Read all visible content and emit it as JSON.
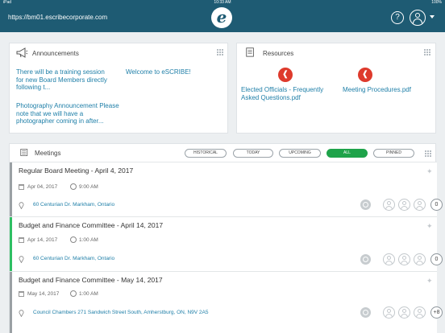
{
  "status_bar": {
    "carrier": "iPad",
    "time": "10:33 AM",
    "battery": "100%"
  },
  "header": {
    "url": "https://bm01.escribecorporate.com",
    "logo_letter": "e",
    "help_glyph": "?"
  },
  "announcements": {
    "title": "Announcements",
    "items": [
      "There will be a training session for new Board Members directly following t...",
      "Welcome to eSCRIBE!",
      "Photography Announcement Please note that we will have a photographer coming in after..."
    ]
  },
  "resources": {
    "title": "Resources",
    "items": [
      {
        "label": "Elected Officials - Frequently Asked Questions.pdf",
        "icon": "pdf-icon"
      },
      {
        "label": "Meeting Procedures.pdf",
        "icon": "pdf-icon"
      }
    ]
  },
  "meetings": {
    "title": "Meetings",
    "filters": [
      {
        "label": "HISTORICAL",
        "active": false
      },
      {
        "label": "TODAY",
        "active": false
      },
      {
        "label": "UPCOMING",
        "active": false
      },
      {
        "label": "ALL",
        "active": true
      },
      {
        "label": "PINNED",
        "active": false
      }
    ],
    "items": [
      {
        "title": "Regular Board Meeting - April 4, 2017",
        "date": "Apr 04, 2017",
        "time": "9:00 AM",
        "location": "60 Centurian Dr. Markham, Ontario",
        "count": "0",
        "accent": "#9aa0a4"
      },
      {
        "title": "Budget and Finance Committee - April 14, 2017",
        "date": "Apr 14, 2017",
        "time": "1:00 AM",
        "location": "60 Centurian Dr. Markham, Ontario",
        "count": "0",
        "accent": "#2ebf63"
      },
      {
        "title": "Budget and Finance Committee - May 14, 2017",
        "date": "May 14, 2017",
        "time": "1:00 AM",
        "location": "Council Chambers 271 Sandwich Street South, Amherstburg, ON, N9V 2A5",
        "count": "+8",
        "accent": "#9aa0a4"
      }
    ]
  },
  "colors": {
    "brand": "#1e5b73",
    "link": "#1f7fa8",
    "active_filter": "#1fa34a",
    "pdf": "#de3a2c"
  }
}
